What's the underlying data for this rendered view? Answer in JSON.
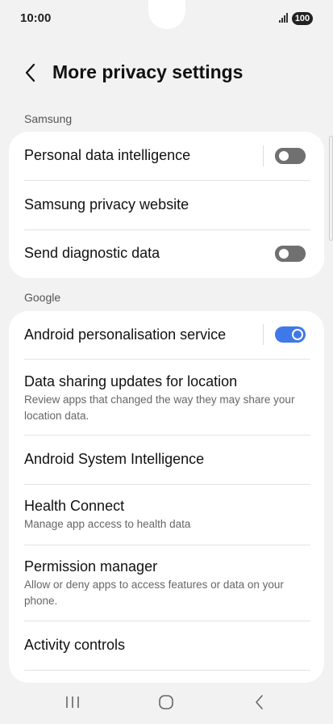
{
  "status": {
    "time": "10:00",
    "battery": "100"
  },
  "header": {
    "title": "More privacy settings"
  },
  "sections": {
    "samsung": {
      "label": "Samsung",
      "items": [
        {
          "title": "Personal data intelligence",
          "toggle": "off"
        },
        {
          "title": "Samsung privacy website"
        },
        {
          "title": "Send diagnostic data",
          "toggle": "off"
        }
      ]
    },
    "google": {
      "label": "Google",
      "items": [
        {
          "title": "Android personalisation service",
          "toggle": "on"
        },
        {
          "title": "Data sharing updates for location",
          "subtitle": "Review apps that changed the way they may share your location data."
        },
        {
          "title": "Android System Intelligence"
        },
        {
          "title": "Health Connect",
          "subtitle": "Manage app access to health data"
        },
        {
          "title": "Permission manager",
          "subtitle": "Allow or deny apps to access features or data on your phone."
        },
        {
          "title": "Activity controls"
        }
      ]
    }
  },
  "colors": {
    "accent": "#3f78e8",
    "background": "#f2f2f2",
    "card": "#ffffff"
  },
  "icons": {
    "back": "chevron-left-icon",
    "recents": "recents-icon",
    "home": "home-icon",
    "nav_back": "nav-back-icon"
  }
}
